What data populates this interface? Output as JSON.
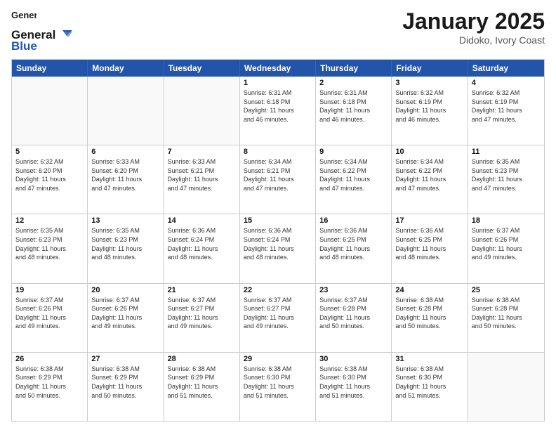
{
  "header": {
    "logo_line1": "General",
    "logo_line2": "Blue",
    "title": "January 2025",
    "location": "Didoko, Ivory Coast"
  },
  "days_of_week": [
    "Sunday",
    "Monday",
    "Tuesday",
    "Wednesday",
    "Thursday",
    "Friday",
    "Saturday"
  ],
  "weeks": [
    [
      {
        "day": "",
        "detail": "",
        "empty": true
      },
      {
        "day": "",
        "detail": "",
        "empty": true
      },
      {
        "day": "",
        "detail": "",
        "empty": true
      },
      {
        "day": "1",
        "detail": "Sunrise: 6:31 AM\nSunset: 6:18 PM\nDaylight: 11 hours\nand 46 minutes.",
        "empty": false
      },
      {
        "day": "2",
        "detail": "Sunrise: 6:31 AM\nSunset: 6:18 PM\nDaylight: 11 hours\nand 46 minutes.",
        "empty": false
      },
      {
        "day": "3",
        "detail": "Sunrise: 6:32 AM\nSunset: 6:19 PM\nDaylight: 11 hours\nand 46 minutes.",
        "empty": false
      },
      {
        "day": "4",
        "detail": "Sunrise: 6:32 AM\nSunset: 6:19 PM\nDaylight: 11 hours\nand 47 minutes.",
        "empty": false
      }
    ],
    [
      {
        "day": "5",
        "detail": "Sunrise: 6:32 AM\nSunset: 6:20 PM\nDaylight: 11 hours\nand 47 minutes.",
        "empty": false
      },
      {
        "day": "6",
        "detail": "Sunrise: 6:33 AM\nSunset: 6:20 PM\nDaylight: 11 hours\nand 47 minutes.",
        "empty": false
      },
      {
        "day": "7",
        "detail": "Sunrise: 6:33 AM\nSunset: 6:21 PM\nDaylight: 11 hours\nand 47 minutes.",
        "empty": false
      },
      {
        "day": "8",
        "detail": "Sunrise: 6:34 AM\nSunset: 6:21 PM\nDaylight: 11 hours\nand 47 minutes.",
        "empty": false
      },
      {
        "day": "9",
        "detail": "Sunrise: 6:34 AM\nSunset: 6:22 PM\nDaylight: 11 hours\nand 47 minutes.",
        "empty": false
      },
      {
        "day": "10",
        "detail": "Sunrise: 6:34 AM\nSunset: 6:22 PM\nDaylight: 11 hours\nand 47 minutes.",
        "empty": false
      },
      {
        "day": "11",
        "detail": "Sunrise: 6:35 AM\nSunset: 6:23 PM\nDaylight: 11 hours\nand 47 minutes.",
        "empty": false
      }
    ],
    [
      {
        "day": "12",
        "detail": "Sunrise: 6:35 AM\nSunset: 6:23 PM\nDaylight: 11 hours\nand 48 minutes.",
        "empty": false
      },
      {
        "day": "13",
        "detail": "Sunrise: 6:35 AM\nSunset: 6:23 PM\nDaylight: 11 hours\nand 48 minutes.",
        "empty": false
      },
      {
        "day": "14",
        "detail": "Sunrise: 6:36 AM\nSunset: 6:24 PM\nDaylight: 11 hours\nand 48 minutes.",
        "empty": false
      },
      {
        "day": "15",
        "detail": "Sunrise: 6:36 AM\nSunset: 6:24 PM\nDaylight: 11 hours\nand 48 minutes.",
        "empty": false
      },
      {
        "day": "16",
        "detail": "Sunrise: 6:36 AM\nSunset: 6:25 PM\nDaylight: 11 hours\nand 48 minutes.",
        "empty": false
      },
      {
        "day": "17",
        "detail": "Sunrise: 6:36 AM\nSunset: 6:25 PM\nDaylight: 11 hours\nand 48 minutes.",
        "empty": false
      },
      {
        "day": "18",
        "detail": "Sunrise: 6:37 AM\nSunset: 6:26 PM\nDaylight: 11 hours\nand 49 minutes.",
        "empty": false
      }
    ],
    [
      {
        "day": "19",
        "detail": "Sunrise: 6:37 AM\nSunset: 6:26 PM\nDaylight: 11 hours\nand 49 minutes.",
        "empty": false
      },
      {
        "day": "20",
        "detail": "Sunrise: 6:37 AM\nSunset: 6:26 PM\nDaylight: 11 hours\nand 49 minutes.",
        "empty": false
      },
      {
        "day": "21",
        "detail": "Sunrise: 6:37 AM\nSunset: 6:27 PM\nDaylight: 11 hours\nand 49 minutes.",
        "empty": false
      },
      {
        "day": "22",
        "detail": "Sunrise: 6:37 AM\nSunset: 6:27 PM\nDaylight: 11 hours\nand 49 minutes.",
        "empty": false
      },
      {
        "day": "23",
        "detail": "Sunrise: 6:37 AM\nSunset: 6:28 PM\nDaylight: 11 hours\nand 50 minutes.",
        "empty": false
      },
      {
        "day": "24",
        "detail": "Sunrise: 6:38 AM\nSunset: 6:28 PM\nDaylight: 11 hours\nand 50 minutes.",
        "empty": false
      },
      {
        "day": "25",
        "detail": "Sunrise: 6:38 AM\nSunset: 6:28 PM\nDaylight: 11 hours\nand 50 minutes.",
        "empty": false
      }
    ],
    [
      {
        "day": "26",
        "detail": "Sunrise: 6:38 AM\nSunset: 6:29 PM\nDaylight: 11 hours\nand 50 minutes.",
        "empty": false
      },
      {
        "day": "27",
        "detail": "Sunrise: 6:38 AM\nSunset: 6:29 PM\nDaylight: 11 hours\nand 50 minutes.",
        "empty": false
      },
      {
        "day": "28",
        "detail": "Sunrise: 6:38 AM\nSunset: 6:29 PM\nDaylight: 11 hours\nand 51 minutes.",
        "empty": false
      },
      {
        "day": "29",
        "detail": "Sunrise: 6:38 AM\nSunset: 6:30 PM\nDaylight: 11 hours\nand 51 minutes.",
        "empty": false
      },
      {
        "day": "30",
        "detail": "Sunrise: 6:38 AM\nSunset: 6:30 PM\nDaylight: 11 hours\nand 51 minutes.",
        "empty": false
      },
      {
        "day": "31",
        "detail": "Sunrise: 6:38 AM\nSunset: 6:30 PM\nDaylight: 11 hours\nand 51 minutes.",
        "empty": false
      },
      {
        "day": "",
        "detail": "",
        "empty": true
      }
    ]
  ]
}
